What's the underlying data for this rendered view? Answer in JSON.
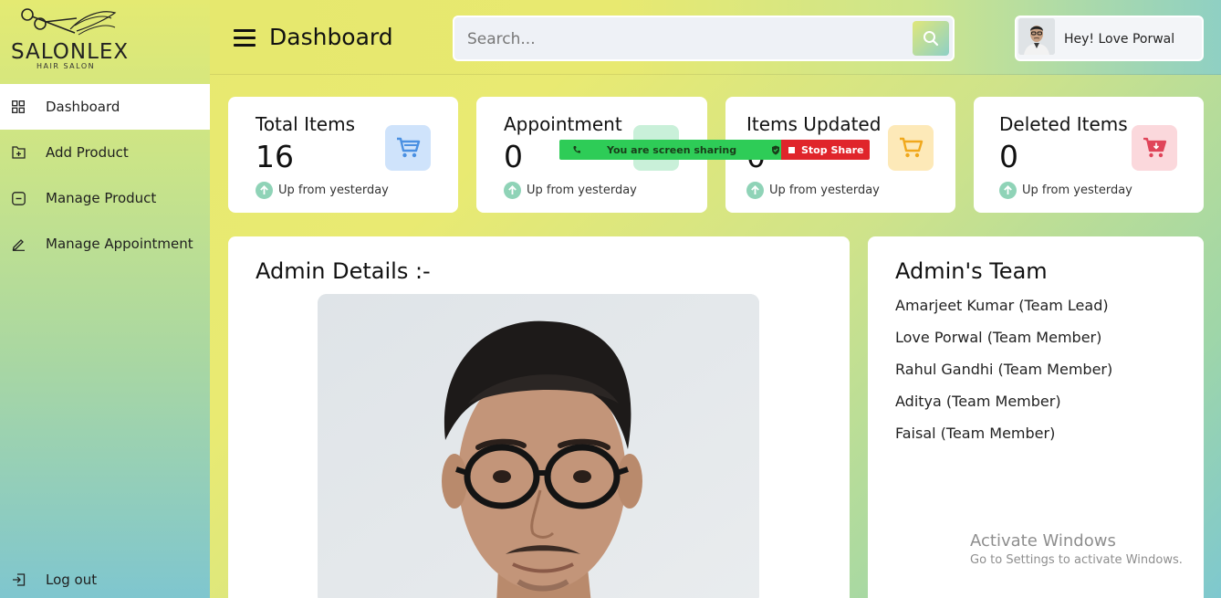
{
  "brand": {
    "name": "SALONLEX",
    "tagline": "HAIR SALON"
  },
  "sidebar": {
    "items": [
      {
        "label": "Dashboard",
        "icon": "grid-icon",
        "active": true
      },
      {
        "label": "Add Product",
        "icon": "add-box-icon"
      },
      {
        "label": "Manage Product",
        "icon": "minus-box-icon"
      },
      {
        "label": "Manage Appointment",
        "icon": "pencil-icon"
      }
    ],
    "logout": {
      "label": "Log out",
      "icon": "logout-icon"
    }
  },
  "header": {
    "title": "Dashboard",
    "search_placeholder": "Search...",
    "user_greeting": "Hey! Love Porwal"
  },
  "stats": [
    {
      "title": "Total Items",
      "value": "16",
      "trend": "Up from yesterday",
      "icon": "cart-icon",
      "color": "#cfe3fb",
      "icon_color": "#4a90e2"
    },
    {
      "title": "Appointment",
      "value": "0",
      "trend": "Up from yesterday",
      "icon": "trend-icon",
      "color": "#c9f0d9",
      "icon_color": "#39c07a"
    },
    {
      "title": "Items Updated",
      "value": "0",
      "trend": "Up from yesterday",
      "icon": "cart-icon",
      "color": "#fde9b8",
      "icon_color": "#f0a81c"
    },
    {
      "title": "Deleted Items",
      "value": "0",
      "trend": "Up from yesterday",
      "icon": "cart-remove-icon",
      "color": "#fbd8dc",
      "icon_color": "#e0455a"
    }
  ],
  "screen_share": {
    "message": "You are screen sharing",
    "stop_label": "Stop Share"
  },
  "admin_details": {
    "title": "Admin Details :-"
  },
  "admin_team": {
    "title": "Admin's Team",
    "members": [
      "Amarjeet Kumar (Team Lead)",
      "Love Porwal (Team Member)",
      "Rahul Gandhi (Team Member)",
      "Aditya (Team Member)",
      "Faisal (Team Member)"
    ]
  },
  "watermark": {
    "line1": "Activate Windows",
    "line2": "Go to Settings to activate Windows."
  }
}
